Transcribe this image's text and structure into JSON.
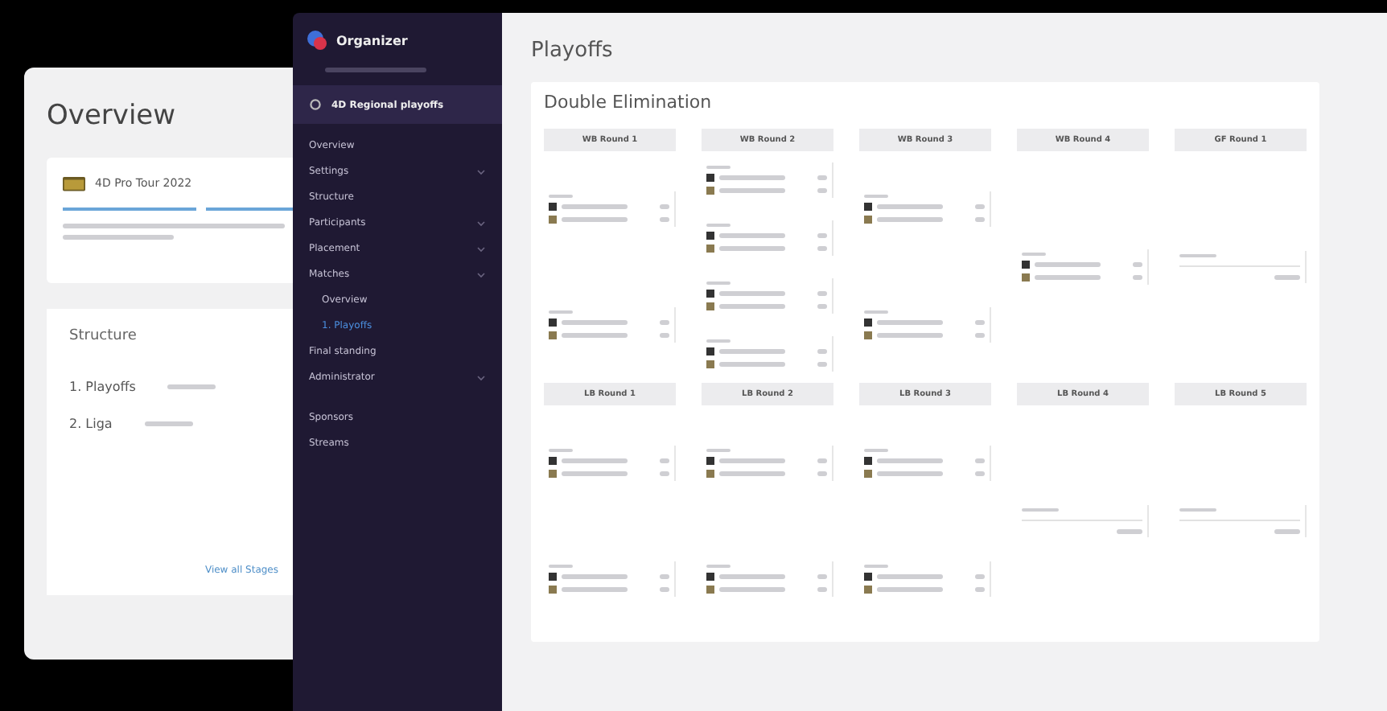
{
  "overview_card": {
    "title": "Overview",
    "event": {
      "name": "4D Pro Tour 2022"
    },
    "structure": {
      "title": "Structure",
      "stages": [
        {
          "name": "1. Playoffs"
        },
        {
          "name": "2. Liga"
        }
      ],
      "link": "View all Stages"
    }
  },
  "sidebar": {
    "brand": "Organizer",
    "project": {
      "name": "4D Regional playoffs",
      "selected": true
    },
    "items": [
      {
        "label": "Overview",
        "has_children": false,
        "selected": false
      },
      {
        "label": "Settings",
        "has_children": true,
        "selected": false
      },
      {
        "label": "Structure",
        "has_children": false,
        "selected": false
      },
      {
        "label": "Participants",
        "has_children": true,
        "selected": false
      },
      {
        "label": "Placement",
        "has_children": true,
        "selected": false
      },
      {
        "label": "Matches",
        "has_children": true,
        "selected": false,
        "children": [
          {
            "label": "Overview",
            "selected": false
          },
          {
            "label": "1. Playoffs",
            "selected": true
          }
        ]
      },
      {
        "label": "Final standing",
        "has_children": false,
        "selected": false
      },
      {
        "label": "Administrator",
        "has_children": true,
        "selected": false
      },
      {
        "label": "Sponsors",
        "has_children": false,
        "selected": false,
        "gap": true
      },
      {
        "label": "Streams",
        "has_children": false,
        "selected": false
      }
    ]
  },
  "page": {
    "title": "Playoffs",
    "panel_title": "Double Elimination",
    "brackets": [
      {
        "rounds": [
          {
            "title": "WB Round 1",
            "matches": [
              {
                "kind": "played"
              },
              {
                "kind": "played"
              }
            ]
          },
          {
            "title": "WB Round 2",
            "matches": [
              {
                "kind": "played"
              },
              {
                "kind": "played"
              },
              {
                "kind": "played"
              },
              {
                "kind": "played"
              }
            ]
          },
          {
            "title": "WB Round 3",
            "matches": [
              {
                "kind": "played"
              },
              {
                "kind": "played"
              }
            ]
          },
          {
            "title": "WB Round 4",
            "matches": [
              {
                "kind": "played"
              }
            ]
          },
          {
            "title": "GF Round 1",
            "matches": [
              {
                "kind": "pending"
              }
            ]
          }
        ]
      },
      {
        "rounds": [
          {
            "title": "LB Round 1",
            "matches": [
              {
                "kind": "played"
              },
              {
                "kind": "played"
              }
            ]
          },
          {
            "title": "LB Round 2",
            "matches": [
              {
                "kind": "played"
              },
              {
                "kind": "played"
              }
            ]
          },
          {
            "title": "LB Round 3",
            "matches": [
              {
                "kind": "played"
              },
              {
                "kind": "played"
              }
            ]
          },
          {
            "title": "LB Round 4",
            "matches": [
              {
                "kind": "pending"
              }
            ]
          },
          {
            "title": "LB Round 5",
            "matches": [
              {
                "kind": "pending"
              }
            ]
          }
        ]
      }
    ]
  }
}
